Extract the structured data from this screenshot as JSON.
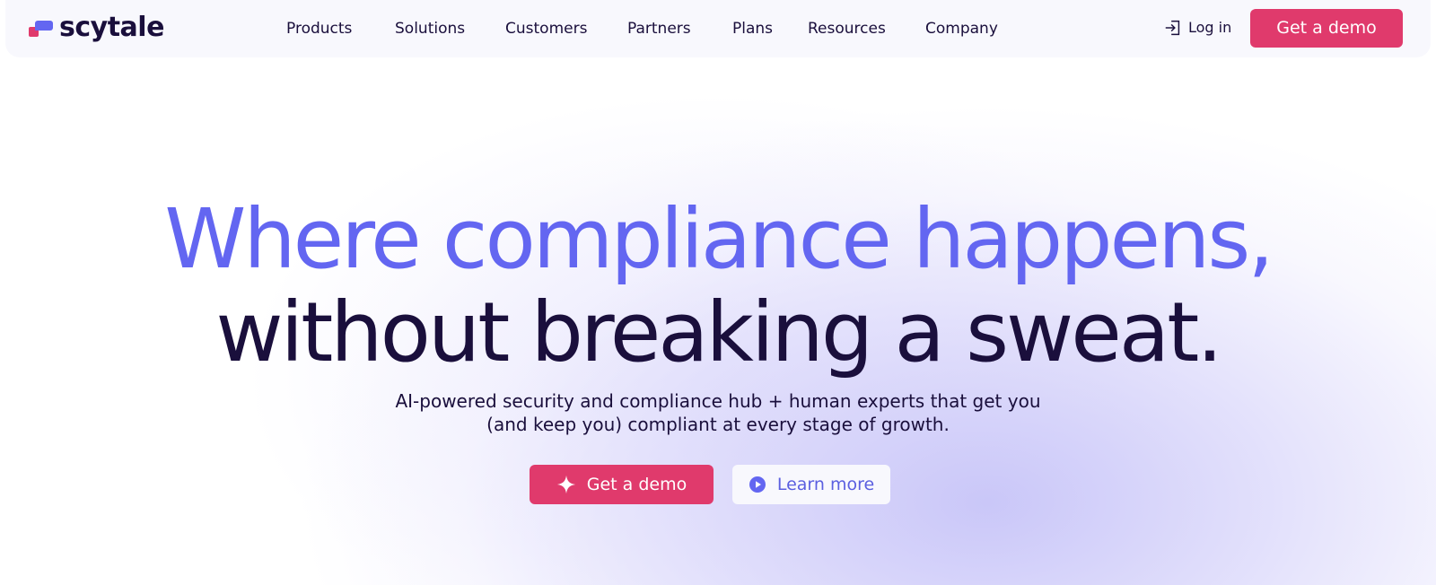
{
  "brand": {
    "name": "scytale",
    "pink": "#e03a6c",
    "indigo": "#6366f1",
    "navy": "#1a0f3c"
  },
  "nav": {
    "items": [
      "Products",
      "Solutions",
      "Customers",
      "Partners",
      "Plans",
      "Resources",
      "Company"
    ],
    "login_label": "Log in",
    "login_icon": "login-icon",
    "demo_label": "Get a demo"
  },
  "hero": {
    "headline_line1": "Where compliance happens,",
    "headline_line2": "without breaking a sweat.",
    "subtitle_line1": "AI-powered security and compliance hub + human experts that get you",
    "subtitle_line2": "(and keep you) compliant at every stage of growth.",
    "primary_cta": {
      "label": "Get a demo",
      "icon": "sparkle-icon"
    },
    "secondary_cta": {
      "label": "Learn more",
      "icon": "play-icon"
    }
  }
}
